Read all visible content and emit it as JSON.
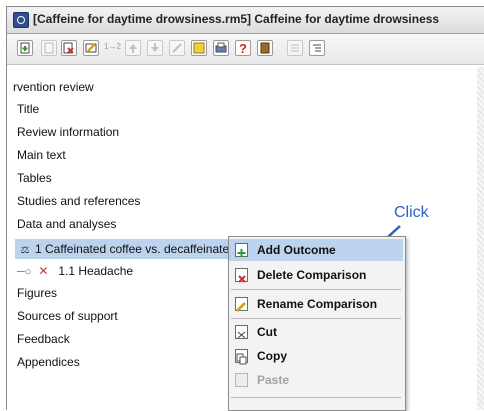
{
  "window": {
    "title": "[Caffeine for daytime drowsiness.rm5] Caffeine for daytime drowsiness"
  },
  "toolbar": {
    "number_label": "1→2"
  },
  "tree": {
    "items": [
      {
        "label": "rvention review"
      },
      {
        "label": "Title"
      },
      {
        "label": "Review information"
      },
      {
        "label": "Main text"
      },
      {
        "label": "Tables"
      },
      {
        "label": "Studies and references"
      },
      {
        "label": "Data and analyses"
      },
      {
        "label": "1 Caffeinated coffee vs. decaffeinated"
      },
      {
        "label": "1.1 Headache"
      },
      {
        "label": "Figures"
      },
      {
        "label": "Sources of support"
      },
      {
        "label": "Feedback"
      },
      {
        "label": "Appendices"
      }
    ]
  },
  "context_menu": {
    "items": [
      {
        "label": "Add Outcome",
        "icon": "add-outcome-icon"
      },
      {
        "label": "Delete Comparison",
        "icon": "delete-icon"
      },
      {
        "label": "Rename Comparison",
        "icon": "rename-icon"
      },
      {
        "label": "Cut",
        "icon": "cut-icon"
      },
      {
        "label": "Copy",
        "icon": "copy-icon"
      },
      {
        "label": "Paste",
        "icon": "paste-icon"
      }
    ]
  },
  "annotation": {
    "text": "Click",
    "color": "#2d5fc8"
  },
  "colors": {
    "selection": "#bcd3ee",
    "outcome_icon": "#d8342f"
  }
}
